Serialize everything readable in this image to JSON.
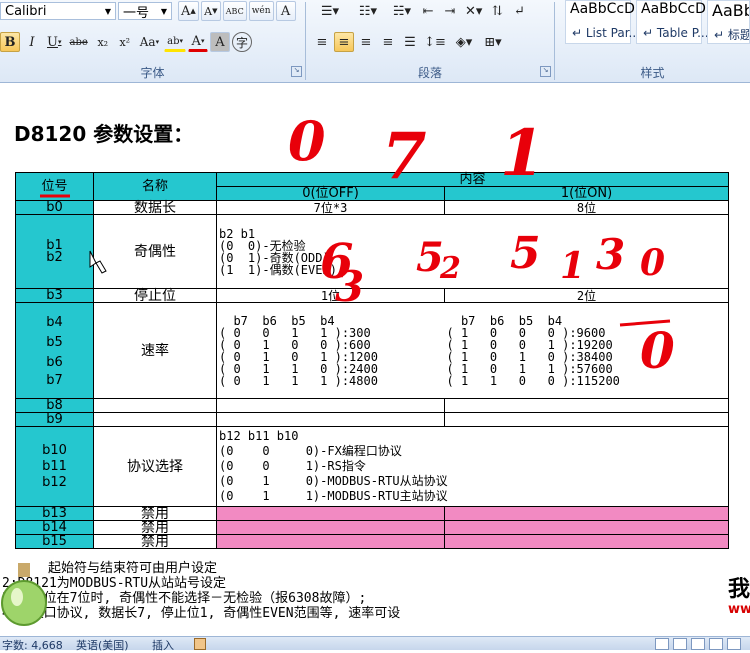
{
  "ribbon": {
    "font_name": "Calibri",
    "font_size": "一号",
    "row1_buttons": [
      "A",
      "A",
      "ABC",
      "wén",
      "A"
    ],
    "row2_format": [
      "B",
      "I",
      "U",
      "abe",
      "x₂",
      "x²",
      "Aa",
      "ab",
      "A",
      "A",
      "字"
    ],
    "font_group_label": "字体",
    "paragraph_group_label": "段落",
    "styles_group_label": "样式",
    "styles": [
      {
        "sample": "AaBbCcD",
        "name": "↵ List Par..."
      },
      {
        "sample": "AaBbCcD",
        "name": "↵ Table P..."
      },
      {
        "sample": "AaBb",
        "name": "↵ 标题"
      }
    ],
    "accent_color": "#dde8f6"
  },
  "document": {
    "heading": "D8120 参数设置：",
    "table": {
      "header": {
        "bit": "位号",
        "name": "名称",
        "content": "内容",
        "col0": "0(位OFF)",
        "col1": "1(位ON)"
      },
      "rows": {
        "b0": {
          "bit": "b0",
          "name": "数据长",
          "v0": "7位*3",
          "v1": "8位"
        },
        "parity": {
          "bits": [
            "b1",
            "b2"
          ],
          "name": "奇偶性",
          "lines": [
            "b2 b1",
            "(0  0)-无检验",
            "(0  1)-奇数(ODD)",
            "(1  1)-偶数(EVEN)"
          ]
        },
        "b3": {
          "bit": "b3",
          "name": "停止位",
          "v0": "1位",
          "v1": "2位"
        },
        "rate": {
          "bits": [
            "b4",
            "b5",
            "b6",
            "b7"
          ],
          "name": "速率",
          "left": [
            "  b7  b6  b5  b4",
            "( 0   0   1   1 ):300",
            "( 0   1   0   0 ):600",
            "( 0   1   0   1 ):1200",
            "( 0   1   1   0 ):2400",
            "( 0   1   1   1 ):4800"
          ],
          "right": [
            "  b7  b6  b5  b4",
            "( 1   0   0   0 ):9600",
            "( 1   0   0   1 ):19200",
            "( 1   0   1   0 ):38400",
            "( 1   0   1   1 ):57600",
            "( 1   1   0   0 ):115200"
          ]
        },
        "b8": {
          "bit": "b8"
        },
        "b9": {
          "bit": "b9"
        },
        "protocol": {
          "bits": [
            "b10",
            "b11",
            "b12"
          ],
          "name": "协议选择",
          "lines": [
            "b12 b11 b10",
            "(0    0     0)-FX编程口协议",
            "(0    0     1)-RS指令",
            "(0    1     0)-MODBUS-RTU从站协议",
            "(0    1     1)-MODBUS-RTU主站协议"
          ]
        },
        "b13": {
          "bit": "b13",
          "name": "禁用"
        },
        "b14": {
          "bit": "b14",
          "name": "禁用"
        },
        "b15": {
          "bit": "b15",
          "name": "禁用"
        }
      }
    },
    "notes": [
      "起始符与结束符可由用户设定",
      "2:D8121为MODBUS-RTU从站站号设定",
      "3:数据位在7位时, 奇偶性不能选择－无检验（报6308故障）;",
      "4:编程口协议, 数据长7, 停止位1, 奇偶性EVEN范围等, 速率可设"
    ],
    "side_char": "我",
    "side_text": "ww",
    "handwriting": [
      "0",
      "7",
      "1",
      "6",
      "5",
      "5",
      "3",
      "0",
      "3",
      "2",
      "1",
      "0"
    ],
    "colors": {
      "header_cyan": "#25c7cf",
      "disabled_pink": "#f28ac2",
      "ink_red": "#e8000a"
    }
  },
  "statusbar": {
    "word_count": "字数: 4,668",
    "language": "英语(美国)",
    "mode": "插入"
  }
}
